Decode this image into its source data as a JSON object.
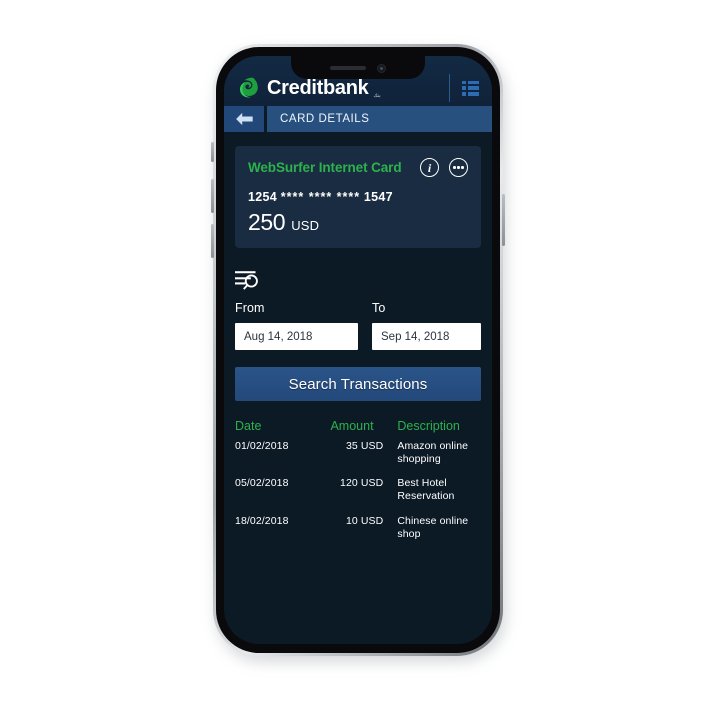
{
  "app": {
    "brand_name": "Creditbank",
    "brand_sub": "بنك",
    "menu_icon": "list-menu-icon"
  },
  "titlebar": {
    "back_icon": "back-arrow-icon",
    "title": "CARD DETAILS"
  },
  "card": {
    "title": "WebSurfer Internet Card",
    "info_icon": "info-circle-icon",
    "more_icon": "more-options-icon",
    "number_prefix": "1254",
    "number_mask": "**** **** ****",
    "number_suffix": "1547",
    "balance_amount": "250",
    "balance_currency": "USD"
  },
  "filter": {
    "search_list_icon": "search-list-icon",
    "from_label": "From",
    "to_label": "To",
    "from_value": "Aug 14, 2018",
    "to_value": "Sep 14, 2018",
    "search_button": "Search Transactions"
  },
  "transactions": {
    "headers": [
      "Date",
      "Amount",
      "Description"
    ],
    "rows": [
      {
        "date": "01/02/2018",
        "amount": "35 USD",
        "description": "Amazon online shopping"
      },
      {
        "date": "05/02/2018",
        "amount": "120 USD",
        "description": "Best Hotel Reservation"
      },
      {
        "date": "18/02/2018",
        "amount": "10 USD",
        "description": "Chinese online shop"
      }
    ]
  },
  "colors": {
    "brand_green": "#2bb24c",
    "screen_bg": "#0c1a26",
    "card_bg": "#1a2c42",
    "header_bg": "#0f2239",
    "title_bar": "#27507f",
    "button_blue": "#2a5489",
    "menu_icon_blue": "#2d6bb5"
  }
}
